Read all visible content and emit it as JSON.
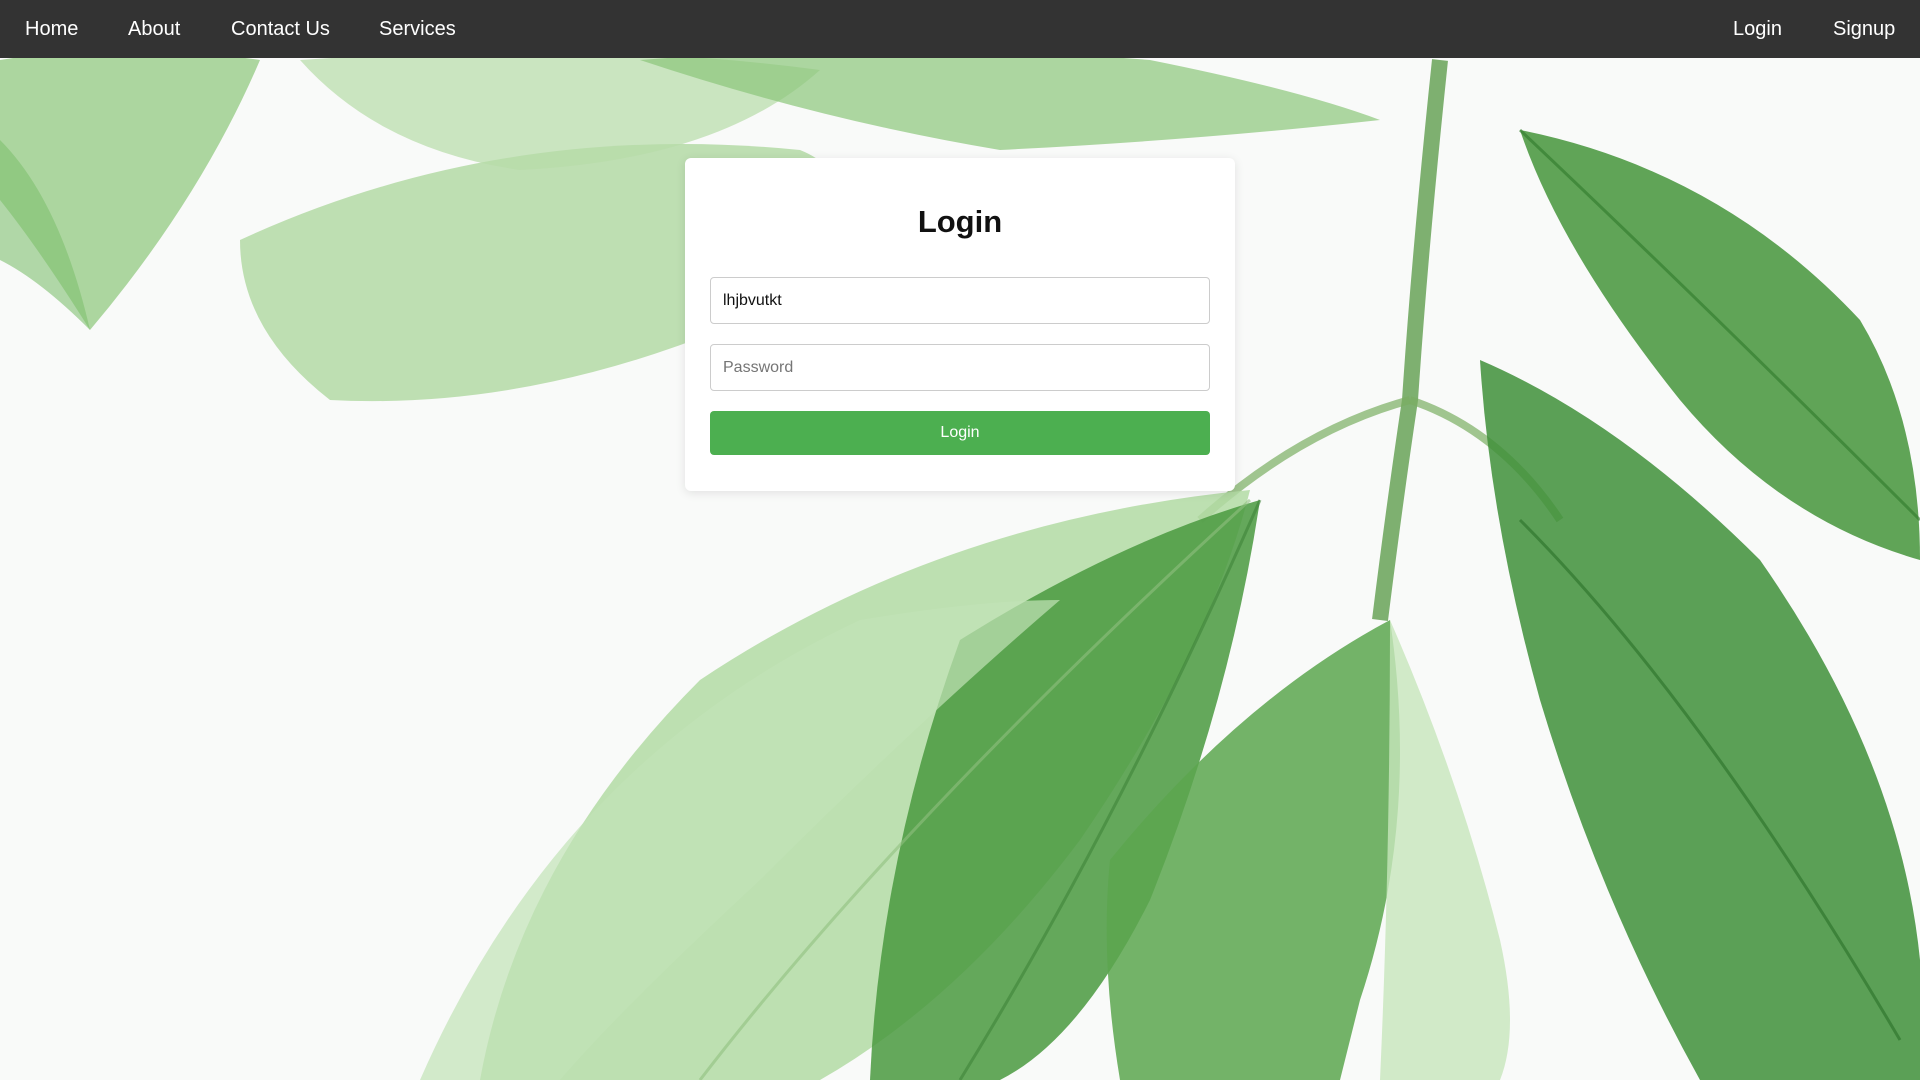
{
  "nav": {
    "left": [
      "Home",
      "About",
      "Contact Us",
      "Services"
    ],
    "right": [
      "Login",
      "Signup"
    ]
  },
  "login_form": {
    "title": "Login",
    "username_value": "lhjbvutkt",
    "password_placeholder": "Password",
    "submit_label": "Login"
  },
  "colors": {
    "navbar": "#333333",
    "button": "#4caf50",
    "card": "#ffffff"
  },
  "background": {
    "description_icon": "green-leaves-photo"
  }
}
